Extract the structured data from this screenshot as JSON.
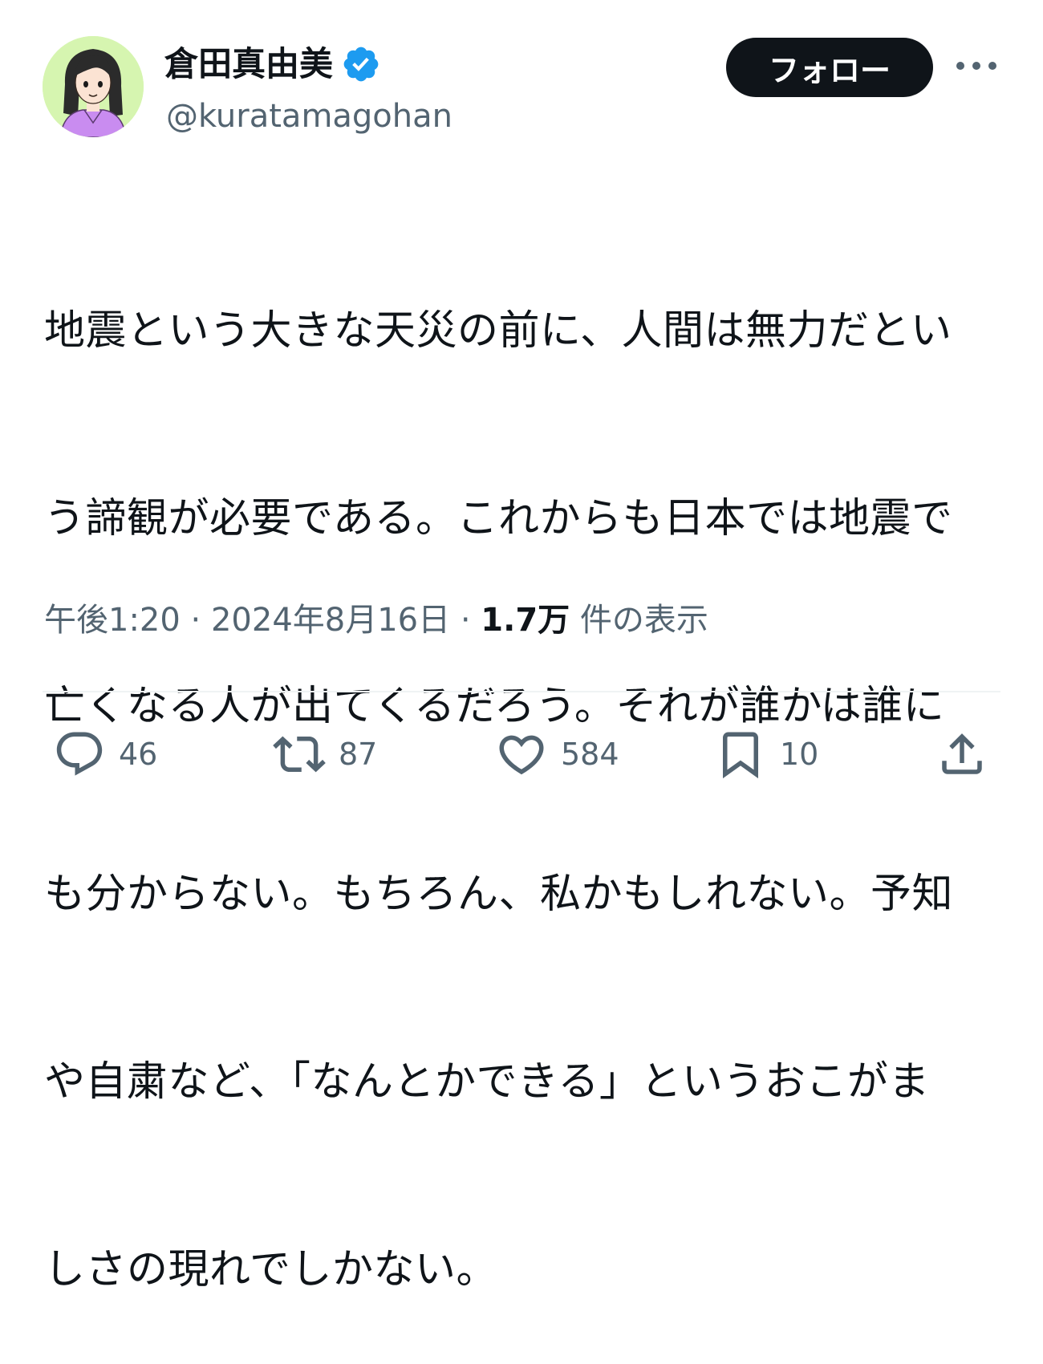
{
  "author": {
    "display_name": "倉田真由美",
    "handle": "@kuratamagohan",
    "verified_badge_icon": "verified-badge-icon",
    "verified_color": "#1d9bf0"
  },
  "header": {
    "follow_label": "フォロー",
    "more_icon": "more-horizontal-icon"
  },
  "tweet": {
    "lines": [
      "地震という大きな天災の前に、人間は無力だとい",
      "う諦観が必要である。これからも日本では地震で",
      "亡くなる人が出てくるだろう。それが誰かは誰に",
      "も分からない。もちろん、私かもしれない。予知",
      "や自粛など、「なんとかできる」というおこがま",
      "しさの現れでしかない。"
    ]
  },
  "meta": {
    "time": "午後1:20",
    "separator": " · ",
    "date": "2024年8月16日",
    "views_count": "1.7万",
    "views_label": " 件の表示"
  },
  "actions": {
    "reply": {
      "icon": "reply-icon",
      "count": "46"
    },
    "repost": {
      "icon": "repost-icon",
      "count": "87"
    },
    "like": {
      "icon": "heart-icon",
      "count": "584"
    },
    "bookmark": {
      "icon": "bookmark-icon",
      "count": "10"
    },
    "share": {
      "icon": "share-icon"
    }
  },
  "colors": {
    "text_primary": "#0f1419",
    "text_secondary": "#536471",
    "avatar_background": "#d6f5b0",
    "avatar_shirt": "#c98cf0"
  }
}
